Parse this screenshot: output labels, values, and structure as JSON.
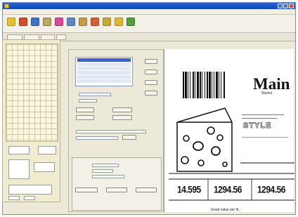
{
  "window": {
    "title": "",
    "title_color": "#1546b6"
  },
  "menus": [
    "",
    "",
    "",
    "",
    ""
  ],
  "toolbar": {
    "tools": [
      {
        "name": "new-icon",
        "color": "#e8c22a"
      },
      {
        "name": "open-icon",
        "color": "#d34d2a"
      },
      {
        "name": "save-icon",
        "color": "#4070c8"
      },
      {
        "name": "print-icon",
        "color": "#b8a860"
      },
      {
        "name": "cut-icon",
        "color": "#d84a9a"
      },
      {
        "name": "copy-icon",
        "color": "#5a88c8"
      },
      {
        "name": "paste-icon",
        "color": "#c89a4a"
      },
      {
        "name": "undo-icon",
        "color": "#d86030"
      },
      {
        "name": "redo-icon",
        "color": "#c8a838"
      },
      {
        "name": "zoom-icon",
        "color": "#e0b830"
      },
      {
        "name": "wizard-icon",
        "color": "#50a040"
      }
    ]
  },
  "label": {
    "brand": "Main",
    "brand_sub": "Market",
    "style_text": "STYLE",
    "prices": [
      "14.595",
      "1294.56",
      "1294.56"
    ],
    "footnote": "Good value per lb."
  }
}
